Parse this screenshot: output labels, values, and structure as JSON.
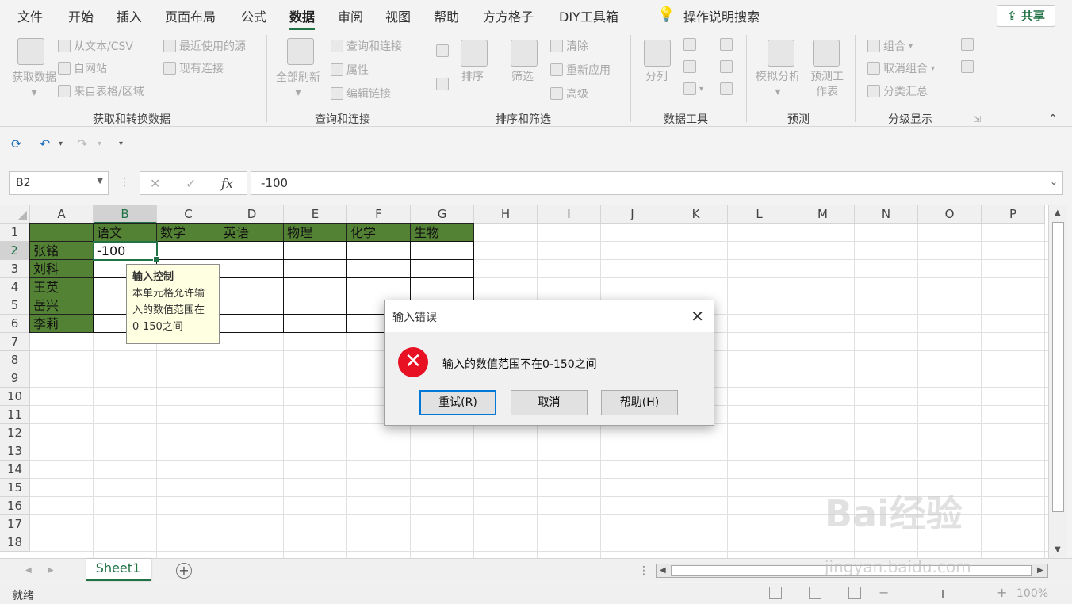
{
  "menu": {
    "tabs": [
      "文件",
      "开始",
      "插入",
      "页面布局",
      "公式",
      "数据",
      "审阅",
      "视图",
      "帮助",
      "方方格子",
      "DIY工具箱"
    ],
    "active": "数据",
    "tell_me": "操作说明搜索",
    "share": "共享"
  },
  "ribbon": {
    "get_data": {
      "big": "获取数据",
      "items": [
        "从文本/CSV",
        "自网站",
        "来自表格/区域",
        "最近使用的源",
        "现有连接"
      ],
      "group": "获取和转换数据"
    },
    "queries": {
      "big": "全部刷新",
      "items": [
        "查询和连接",
        "属性",
        "编辑链接"
      ],
      "group": "查询和连接"
    },
    "sort": {
      "sort": "排序",
      "filter": "筛选",
      "items": [
        "清除",
        "重新应用",
        "高级"
      ],
      "group": "排序和筛选"
    },
    "tools": {
      "big": "分列",
      "group": "数据工具"
    },
    "forecast": {
      "whatif": "模拟分析",
      "sheet": "预测工作表",
      "group": "预测"
    },
    "outline": {
      "items": [
        "组合",
        "取消组合",
        "分类汇总"
      ],
      "group": "分级显示"
    }
  },
  "formula_bar": {
    "name_box": "B2",
    "fx": "fx",
    "value": "-100"
  },
  "grid": {
    "columns": [
      "A",
      "B",
      "C",
      "D",
      "E",
      "F",
      "G",
      "H",
      "I",
      "J",
      "K",
      "L",
      "M",
      "N",
      "O",
      "P"
    ],
    "rows": [
      "1",
      "2",
      "3",
      "4",
      "5",
      "6",
      "7",
      "8",
      "9",
      "10",
      "11",
      "12",
      "13",
      "14",
      "15",
      "16",
      "17",
      "18"
    ],
    "header_row": [
      "语文",
      "数学",
      "英语",
      "物理",
      "化学",
      "生物"
    ],
    "names": [
      "张铭",
      "刘科",
      "王英",
      "岳兴",
      "李莉"
    ],
    "b2_value": "-100"
  },
  "input_message": {
    "title": "输入控制",
    "body": "本单元格允许输入的数值范围在0-150之间"
  },
  "dialog": {
    "title": "输入错误",
    "message": "输入的数值范围不在0-150之间",
    "retry": "重试(R)",
    "cancel": "取消",
    "help": "帮助(H)"
  },
  "sheets": {
    "active": "Sheet1"
  },
  "status": {
    "ready": "就绪",
    "zoom": "100%"
  },
  "watermark": {
    "logo": "Bai经验",
    "url": "jingyan.baidu.com"
  }
}
